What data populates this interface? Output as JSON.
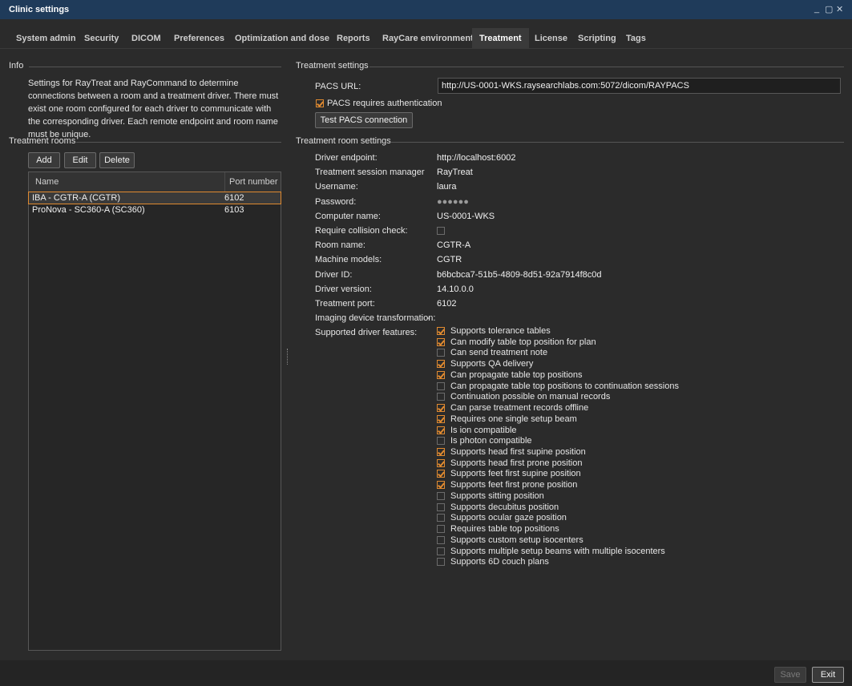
{
  "window": {
    "title": "Clinic settings",
    "controls": "_ ▢ ✕"
  },
  "tabs": [
    "System admin",
    "Security",
    "DICOM",
    "Preferences",
    "Optimization and dose",
    "Reports",
    "RayCare environment",
    "Treatment",
    "License",
    "Scripting",
    "Tags"
  ],
  "active_tab": "Treatment",
  "info": {
    "header": "Info",
    "text": "Settings for RayTreat and RayCommand to determine connections between a room and a treatment driver. There must exist one room configured for each driver to communicate with the corresponding driver. Each remote endpoint and room name must be unique."
  },
  "rooms": {
    "header": "Treatment rooms",
    "buttons": {
      "add": "Add",
      "edit": "Edit",
      "delete": "Delete"
    },
    "columns": {
      "name": "Name",
      "port": "Port number"
    },
    "rows": [
      {
        "name": "IBA - CGTR-A (CGTR)",
        "port": "6102"
      },
      {
        "name": "ProNova - SC360-A (SC360)",
        "port": "6103"
      }
    ]
  },
  "treatment_settings": {
    "header": "Treatment settings",
    "pacs_url_label": "PACS URL:",
    "pacs_url": "http://US-0001-WKS.raysearchlabs.com:5072/dicom/RAYPACS",
    "pacs_auth_label": "PACS requires authentication",
    "pacs_auth_checked": true,
    "test_button": "Test PACS connection"
  },
  "room_settings": {
    "header": "Treatment room settings",
    "fields": [
      {
        "label": "Driver endpoint:",
        "value": "http://localhost:6002"
      },
      {
        "label": "Treatment session manager",
        "value": "RayTreat"
      },
      {
        "label": "Username:",
        "value": "laura"
      },
      {
        "label": "Password:",
        "value": "●●●●●●"
      },
      {
        "label": "Computer name:",
        "value": "US-0001-WKS"
      },
      {
        "label": "Require collision check:",
        "value": ""
      },
      {
        "label": "Room name:",
        "value": "CGTR-A"
      },
      {
        "label": "Machine models:",
        "value": "CGTR"
      },
      {
        "label": "Driver ID:",
        "value": "b6bcbca7-51b5-4809-8d51-92a7914f8c0d"
      },
      {
        "label": "Driver version:",
        "value": "14.10.0.0"
      },
      {
        "label": "Treatment port:",
        "value": "6102"
      },
      {
        "label": "Imaging device transformation:",
        "value": "-"
      },
      {
        "label": "Supported driver features:",
        "value": ""
      }
    ],
    "features": [
      {
        "label": "Supports tolerance tables",
        "checked": true
      },
      {
        "label": "Can modify table top position for plan",
        "checked": true
      },
      {
        "label": "Can send treatment note",
        "checked": false
      },
      {
        "label": "Supports QA delivery",
        "checked": true
      },
      {
        "label": "Can propagate table top positions",
        "checked": true
      },
      {
        "label": "Can propagate table top positions to continuation sessions",
        "checked": false
      },
      {
        "label": "Continuation possible on manual records",
        "checked": false
      },
      {
        "label": "Can parse treatment records offline",
        "checked": true
      },
      {
        "label": "Requires one single setup beam",
        "checked": true
      },
      {
        "label": "Is ion compatible",
        "checked": true
      },
      {
        "label": "Is photon compatible",
        "checked": false
      },
      {
        "label": "Supports head first supine position",
        "checked": true
      },
      {
        "label": "Supports head first prone position",
        "checked": true
      },
      {
        "label": "Supports feet first supine position",
        "checked": true
      },
      {
        "label": "Supports feet first prone position",
        "checked": true
      },
      {
        "label": "Supports sitting position",
        "checked": false
      },
      {
        "label": "Supports decubitus position",
        "checked": false
      },
      {
        "label": "Supports ocular gaze position",
        "checked": false
      },
      {
        "label": "Requires table top positions",
        "checked": false
      },
      {
        "label": "Supports custom setup isocenters",
        "checked": false
      },
      {
        "label": "Supports multiple setup beams with multiple isocenters",
        "checked": false
      },
      {
        "label": "Supports 6D couch plans",
        "checked": false
      }
    ]
  },
  "footer": {
    "save": "Save",
    "exit": "Exit"
  },
  "colors": {
    "accent": "#e08a30",
    "titlebar": "#1f3b5a",
    "background": "#2b2b2b"
  }
}
